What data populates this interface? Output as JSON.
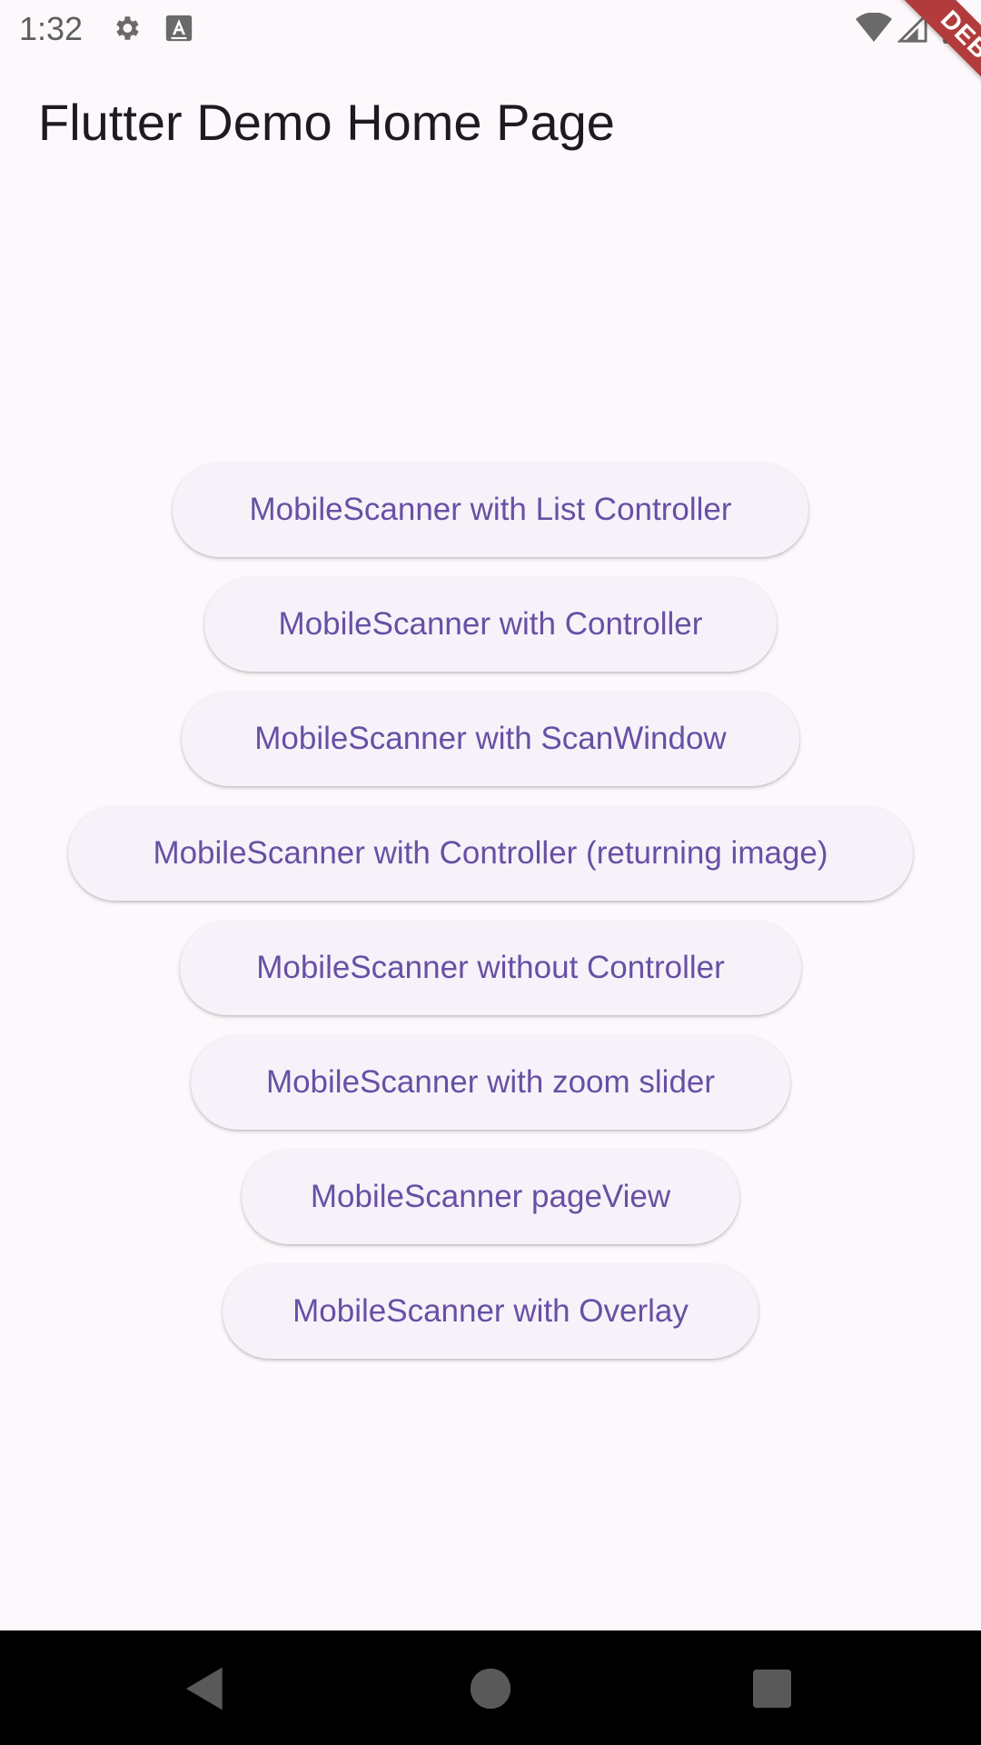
{
  "status_bar": {
    "time": "1:32",
    "icons": [
      "gear-icon",
      "text-input-icon",
      "wifi-icon",
      "signal-icon",
      "battery-icon"
    ]
  },
  "debug_banner": {
    "label": "DEBUG",
    "color": "#b23b3b"
  },
  "app_bar": {
    "title": "Flutter Demo Home Page"
  },
  "buttons": [
    {
      "label": "MobileScanner with List Controller"
    },
    {
      "label": "MobileScanner with Controller"
    },
    {
      "label": "MobileScanner with ScanWindow"
    },
    {
      "label": "MobileScanner with Controller (returning image)"
    },
    {
      "label": "MobileScanner without Controller"
    },
    {
      "label": "MobileScanner with zoom slider"
    },
    {
      "label": "MobileScanner pageView"
    },
    {
      "label": "MobileScanner with Overlay"
    }
  ],
  "nav_bar": {
    "icons": [
      "back-icon",
      "home-icon",
      "recents-icon"
    ]
  },
  "colors": {
    "background": "#fdf8fc",
    "button_bg": "#f7f2fa",
    "button_text": "#6750a4",
    "nav_bar": "#000000"
  }
}
